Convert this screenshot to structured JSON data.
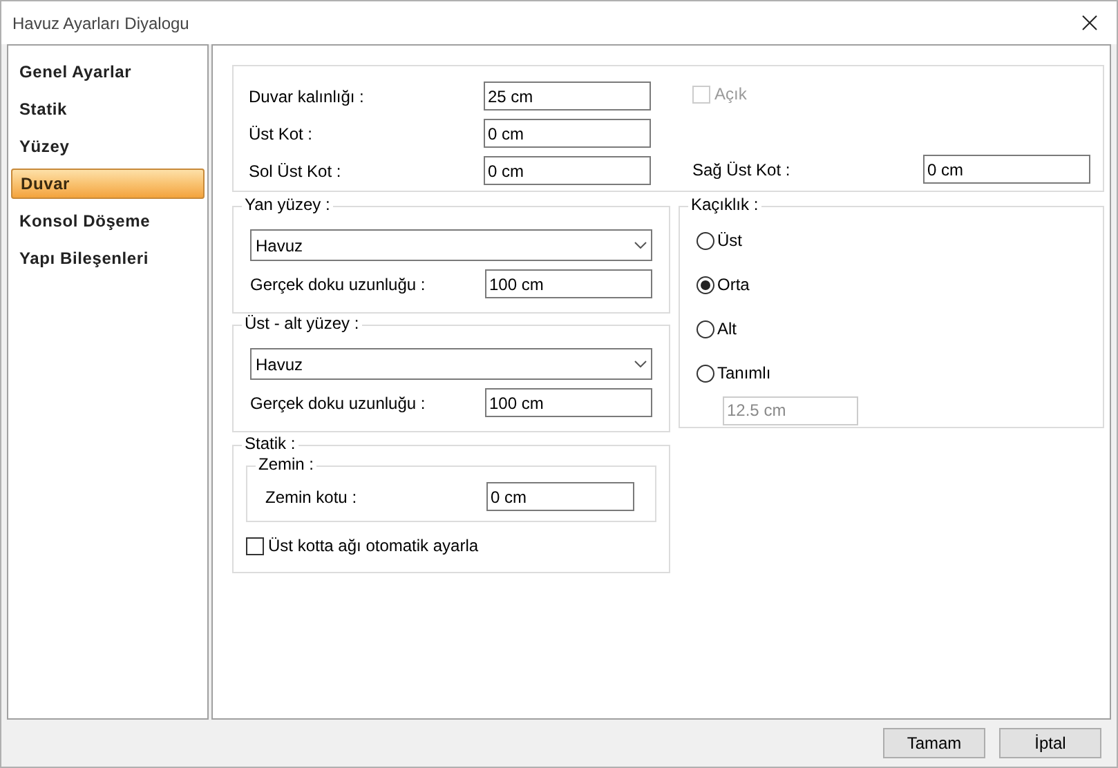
{
  "window": {
    "title": "Havuz Ayarları Diyalogu"
  },
  "sidebar": {
    "items": [
      {
        "label": "Genel Ayarlar",
        "selected": false
      },
      {
        "label": "Statik",
        "selected": false
      },
      {
        "label": "Yüzey",
        "selected": false
      },
      {
        "label": "Duvar",
        "selected": true
      },
      {
        "label": "Konsol Döşeme",
        "selected": false
      },
      {
        "label": "Yapı Bileşenleri",
        "selected": false
      }
    ]
  },
  "wall": {
    "thickness_label": "Duvar kalınlığı :",
    "thickness": "25 cm",
    "top_label": "Üst Kot :",
    "top": "0 cm",
    "left_top_label": "Sol Üst Kot :",
    "left_top": "0 cm",
    "open": {
      "label": "Açık",
      "checked": false,
      "disabled": true
    },
    "right_top_label": "Sağ Üst Kot :",
    "right_top": "0 cm"
  },
  "side_surface": {
    "title": "Yan yüzey :",
    "material": "Havuz",
    "length_label": "Gerçek doku uzunluğu :",
    "length": "100 cm"
  },
  "top_bottom_surface": {
    "title": "Üst - alt yüzey :",
    "material": "Havuz",
    "length_label": "Gerçek doku uzunluğu :",
    "length": "100 cm"
  },
  "static": {
    "title": "Statik :",
    "ground_title": "Zemin :",
    "ground_label": "Zemin kotu :",
    "ground": "0 cm",
    "auto": {
      "label": "Üst kotta ağı otomatik ayarla",
      "checked": false
    }
  },
  "offset": {
    "title": "Kaçıklık :",
    "options": [
      {
        "label": "Üst",
        "selected": false
      },
      {
        "label": "Orta",
        "selected": true
      },
      {
        "label": "Alt",
        "selected": false
      },
      {
        "label": "Tanımlı",
        "selected": false
      }
    ],
    "custom": "12.5 cm",
    "custom_disabled": true
  },
  "buttons": [
    "Tamam",
    "İptal"
  ]
}
